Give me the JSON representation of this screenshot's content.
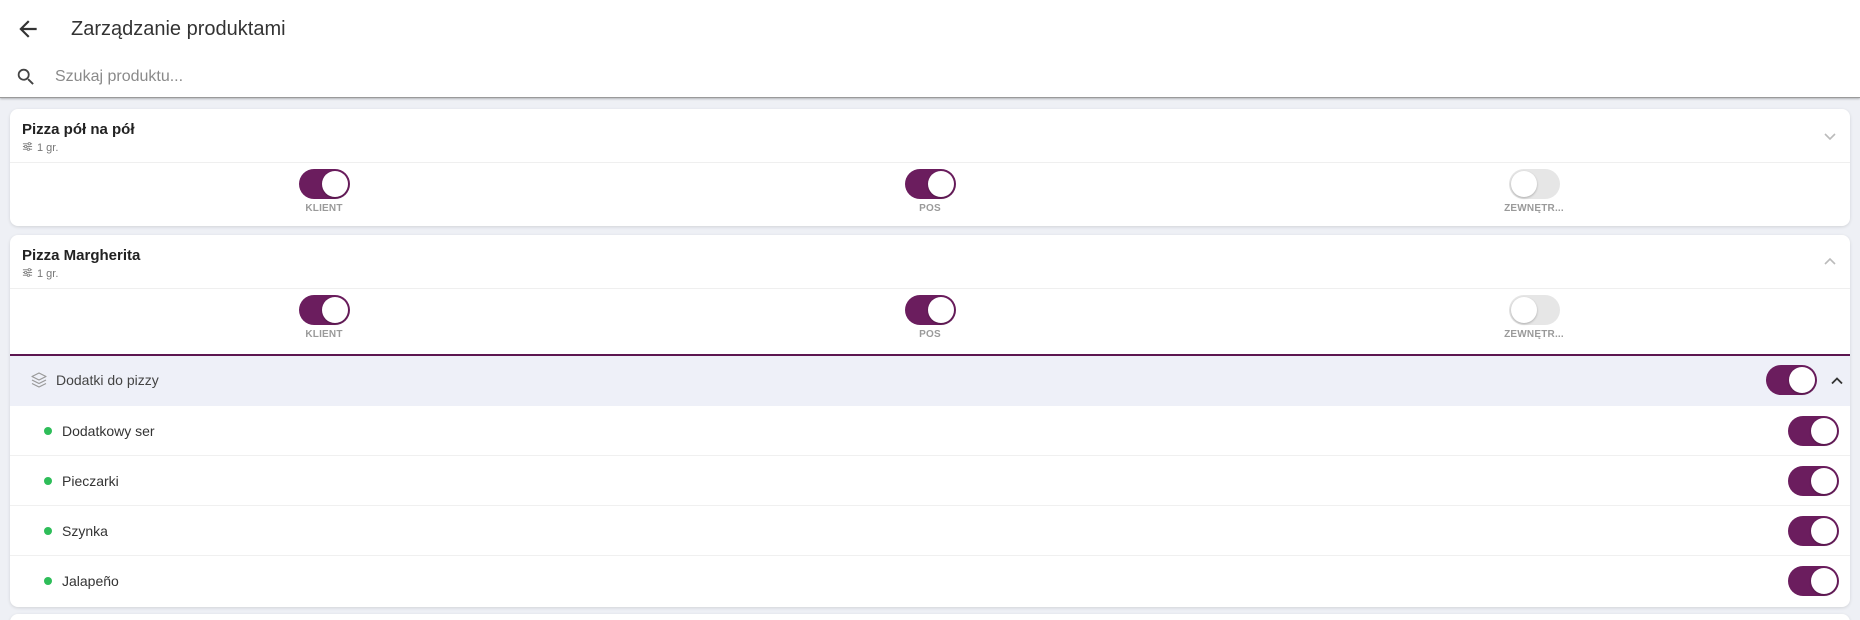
{
  "header": {
    "title": "Zarządzanie produktami"
  },
  "search": {
    "placeholder": "Szukaj produktu..."
  },
  "products": [
    {
      "name": "Pizza pół na pół",
      "groups_count": "1 gr.",
      "expanded": false,
      "channels": [
        {
          "label": "KLIENT",
          "enabled": true
        },
        {
          "label": "POS",
          "enabled": true
        },
        {
          "label": "ZEWNĘTR...",
          "enabled": false
        }
      ]
    },
    {
      "name": "Pizza Margherita",
      "groups_count": "1 gr.",
      "expanded": true,
      "channels": [
        {
          "label": "KLIENT",
          "enabled": true
        },
        {
          "label": "POS",
          "enabled": true
        },
        {
          "label": "ZEWNĘTR...",
          "enabled": false
        }
      ],
      "groups": [
        {
          "name": "Dodatki do pizzy",
          "enabled": true,
          "items": [
            {
              "name": "Dodatkowy ser",
              "available": true,
              "enabled": true
            },
            {
              "name": "Pieczarki",
              "available": true,
              "enabled": true
            },
            {
              "name": "Szynka",
              "available": true,
              "enabled": true
            },
            {
              "name": "Jalapeño",
              "available": true,
              "enabled": true
            }
          ]
        }
      ]
    }
  ],
  "colors": {
    "accent": "#6b1d5e",
    "toggle_off": "#e6e6e6",
    "available_dot": "#2ebd59",
    "group_bg": "#eef0f8"
  }
}
